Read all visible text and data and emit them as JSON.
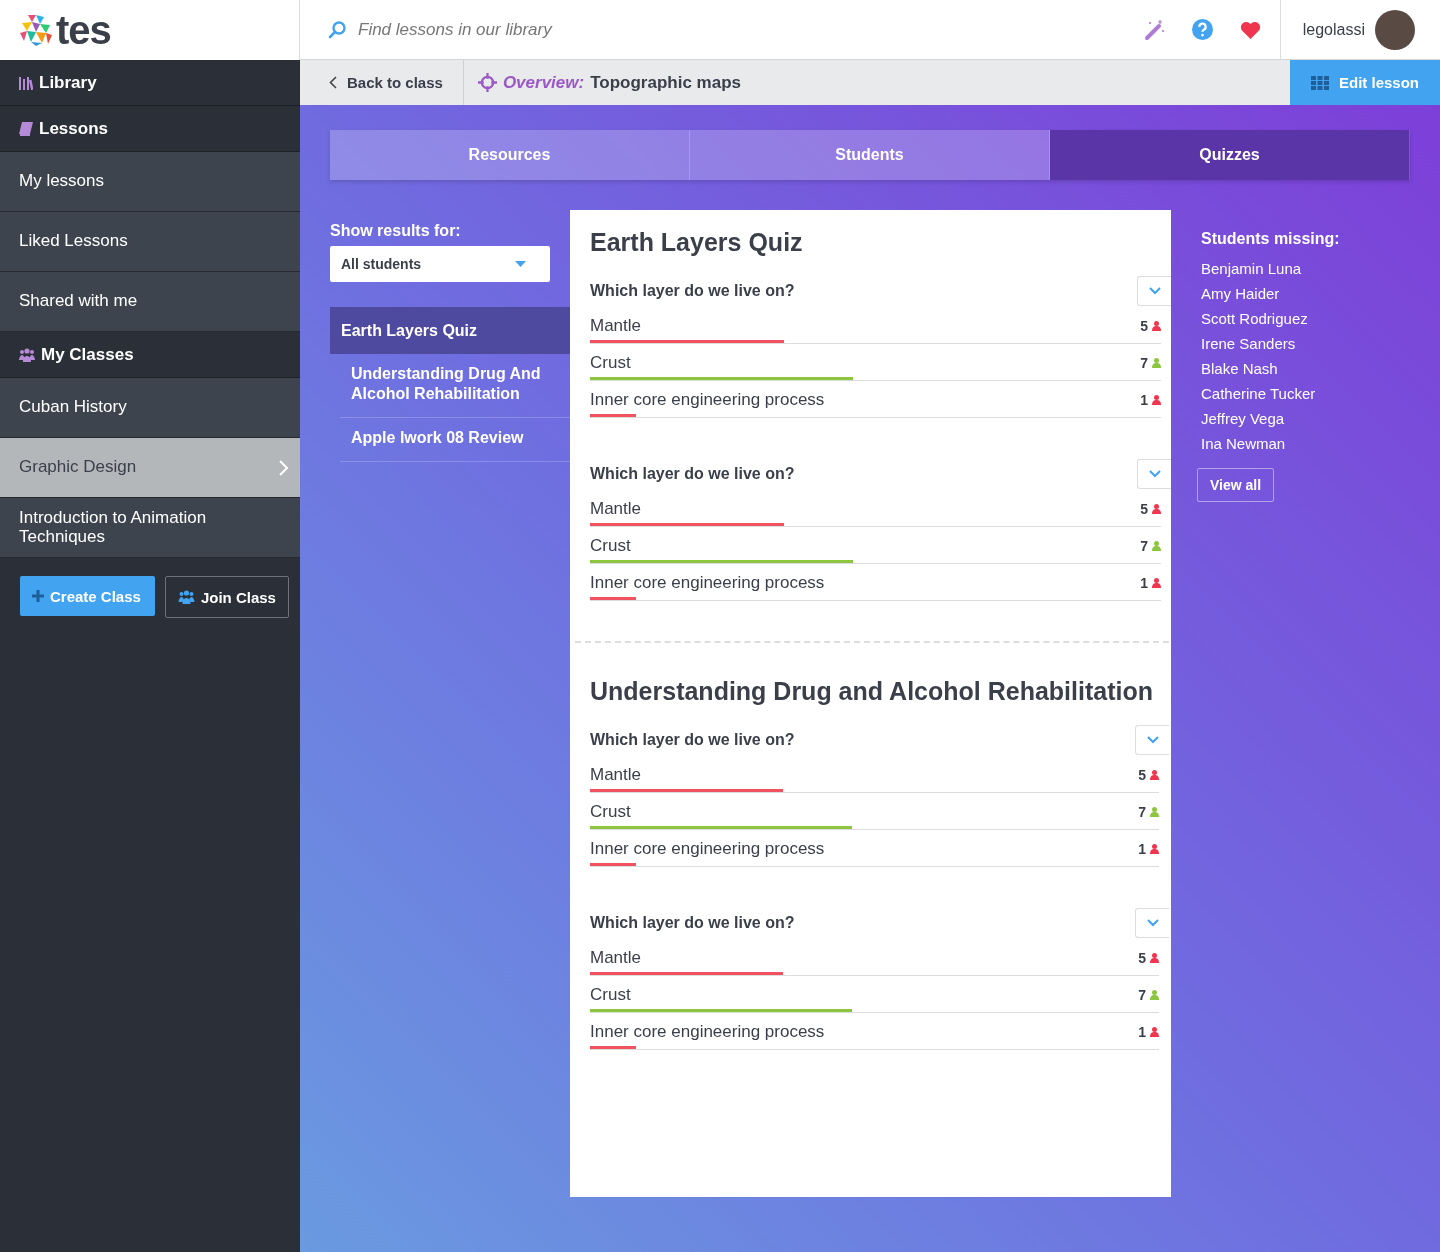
{
  "topbar": {
    "logo": "tes",
    "search_placeholder": "Find lessons in our library",
    "username": "legolassi"
  },
  "breadcrumb": {
    "back": "Back to class",
    "overview_label": "Overview:",
    "title": "Topographic maps",
    "edit": "Edit lesson"
  },
  "sidebar": {
    "items": [
      {
        "kind": "header",
        "label": "Library"
      },
      {
        "kind": "header",
        "label": "Lessons"
      },
      {
        "kind": "item",
        "label": "My lessons",
        "selected": false
      },
      {
        "kind": "item",
        "label": "Liked Lessons",
        "selected": false
      },
      {
        "kind": "item",
        "label": "Shared with me",
        "selected": false
      },
      {
        "kind": "header",
        "label": "My Classes"
      },
      {
        "kind": "item",
        "label": "Cuban History",
        "selected": false
      },
      {
        "kind": "item",
        "label": "Graphic Design",
        "selected": true
      },
      {
        "kind": "item",
        "label": "Introduction to Animation Techniques",
        "selected": false
      }
    ],
    "buttons": [
      "Create Class",
      "Join Class"
    ]
  },
  "tabs": [
    {
      "label": "Resources",
      "selected": false
    },
    {
      "label": "Students",
      "selected": false
    },
    {
      "label": "Quizzes",
      "selected": true
    }
  ],
  "filter": {
    "label": "Show results for:",
    "value": "All students"
  },
  "quiz_list": [
    {
      "label": "Earth Layers Quiz",
      "selected": true
    },
    {
      "label": "Understanding Drug And Alcohol Rehabilitation",
      "selected": false
    },
    {
      "label": "Apple Iwork 08 Review",
      "selected": false
    }
  ],
  "quizzes": [
    {
      "title": "Earth Layers Quiz",
      "questions": [
        {
          "text": "Which layer do we live on?",
          "answers": [
            {
              "label": "Mantle",
              "count": "5",
              "correct": false,
              "level": 0.34
            },
            {
              "label": "Crust",
              "count": "7",
              "correct": true,
              "level": 0.46
            },
            {
              "label": "Inner core engineering process",
              "count": "1",
              "correct": false,
              "level": 0.08
            }
          ]
        },
        {
          "text": "Which layer do we live on?",
          "answers": [
            {
              "label": "Mantle",
              "count": "5",
              "correct": false,
              "level": 0.34
            },
            {
              "label": "Crust",
              "count": "7",
              "correct": true,
              "level": 0.46
            },
            {
              "label": "Inner core engineering process",
              "count": "1",
              "correct": false,
              "level": 0.08
            }
          ]
        }
      ]
    },
    {
      "title": "Understanding Drug and Alcohol Rehabilitation",
      "questions": [
        {
          "text": "Which layer do we live on?",
          "answers": [
            {
              "label": "Mantle",
              "count": "5",
              "correct": false,
              "level": 0.34
            },
            {
              "label": "Crust",
              "count": "7",
              "correct": true,
              "level": 0.46
            },
            {
              "label": "Inner core engineering process",
              "count": "1",
              "correct": false,
              "level": 0.08
            }
          ]
        },
        {
          "text": "Which layer do we live on?",
          "answers": [
            {
              "label": "Mantle",
              "count": "5",
              "correct": false,
              "level": 0.34
            },
            {
              "label": "Crust",
              "count": "7",
              "correct": true,
              "level": 0.46
            },
            {
              "label": "Inner core engineering process",
              "count": "1",
              "correct": false,
              "level": 0.08
            }
          ]
        }
      ]
    }
  ],
  "missing": {
    "title": "Students missing:",
    "students": [
      "Benjamin Luna",
      "Amy Haider",
      "Scott Rodriguez",
      "Irene Sanders",
      "Blake Nash",
      "Catherine Tucker",
      "Jeffrey Vega",
      "Ina Newman"
    ],
    "view_all": "View all"
  }
}
